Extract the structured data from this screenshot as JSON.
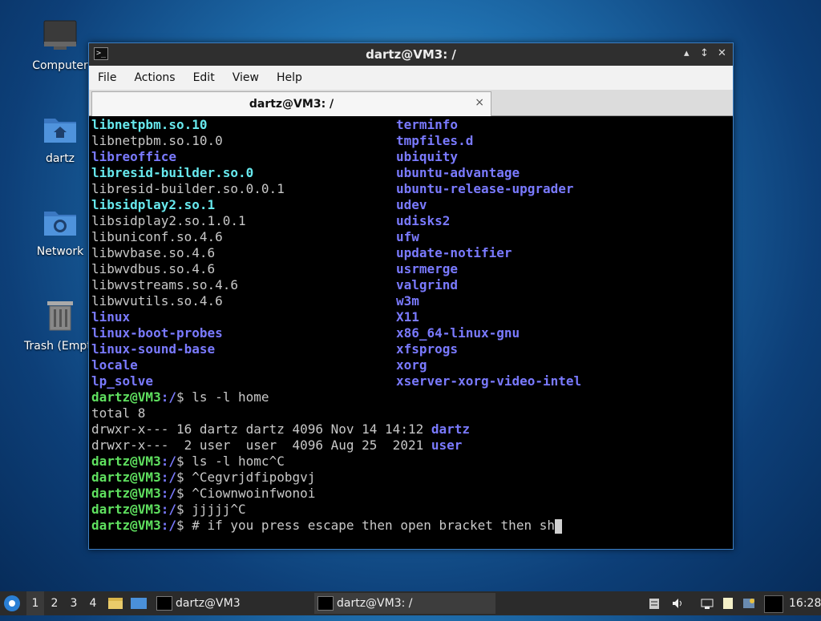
{
  "desktop": {
    "icons": [
      {
        "label": "Computer"
      },
      {
        "label": "dartz"
      },
      {
        "label": "Network"
      },
      {
        "label": "Trash (Empty)"
      }
    ]
  },
  "window": {
    "title": "dartz@VM3: /",
    "menu": [
      "File",
      "Actions",
      "Edit",
      "View",
      "Help"
    ],
    "tab_label": "dartz@VM3: /",
    "tab_close": "×",
    "controls": {
      "minimize": "▴",
      "maximize": "↕",
      "close": "✕"
    }
  },
  "terminal": {
    "listing": [
      {
        "left": "libnetpbm.so.10",
        "lc": "cy",
        "right": "terminfo",
        "rc": "bl"
      },
      {
        "left": "libnetpbm.so.10.0",
        "lc": "w",
        "right": "tmpfiles.d",
        "rc": "bl"
      },
      {
        "left": "libreoffice",
        "lc": "bl",
        "right": "ubiquity",
        "rc": "bl"
      },
      {
        "left": "libresid-builder.so.0",
        "lc": "cy",
        "right": "ubuntu-advantage",
        "rc": "bl"
      },
      {
        "left": "libresid-builder.so.0.0.1",
        "lc": "w",
        "right": "ubuntu-release-upgrader",
        "rc": "bl"
      },
      {
        "left": "libsidplay2.so.1",
        "lc": "cy",
        "right": "udev",
        "rc": "bl"
      },
      {
        "left": "libsidplay2.so.1.0.1",
        "lc": "w",
        "right": "udisks2",
        "rc": "bl"
      },
      {
        "left": "libuniconf.so.4.6",
        "lc": "w",
        "right": "ufw",
        "rc": "bl"
      },
      {
        "left": "libwvbase.so.4.6",
        "lc": "w",
        "right": "update-notifier",
        "rc": "bl"
      },
      {
        "left": "libwvdbus.so.4.6",
        "lc": "w",
        "right": "usrmerge",
        "rc": "bl"
      },
      {
        "left": "libwvstreams.so.4.6",
        "lc": "w",
        "right": "valgrind",
        "rc": "bl"
      },
      {
        "left": "libwvutils.so.4.6",
        "lc": "w",
        "right": "w3m",
        "rc": "bl"
      },
      {
        "left": "linux",
        "lc": "bl",
        "right": "X11",
        "rc": "bl"
      },
      {
        "left": "linux-boot-probes",
        "lc": "bl",
        "right": "x86_64-linux-gnu",
        "rc": "bl"
      },
      {
        "left": "linux-sound-base",
        "lc": "bl",
        "right": "xfsprogs",
        "rc": "bl"
      },
      {
        "left": "locale",
        "lc": "bl",
        "right": "xorg",
        "rc": "bl"
      },
      {
        "left": "lp_solve",
        "lc": "bl",
        "right": "xserver-xorg-video-intel",
        "rc": "bl"
      }
    ],
    "prompt_user": "dartz@VM3",
    "prompt_path": ":/",
    "prompt_sign": "$ ",
    "cmd1": "ls -l home",
    "total": "total 8",
    "ls_rows": [
      {
        "text": "drwxr-x--- 16 dartz dartz 4096 Nov 14 14:12 ",
        "name": "dartz"
      },
      {
        "text": "drwxr-x---  2 user  user  4096 Aug 25  2021 ",
        "name": "user"
      }
    ],
    "cmd2": "ls -l homc^C",
    "cmd3": "^Cegvrjdfipobgvj",
    "cmd4": "^Ciownwoinfwonoi",
    "cmd5": "jjjjj^C",
    "cmd6": "# if you press escape then open bracket then sh"
  },
  "taskbar": {
    "workspaces": [
      "1",
      "2",
      "3",
      "4"
    ],
    "tasks": [
      {
        "label": "dartz@VM3"
      },
      {
        "label": "dartz@VM3: /"
      }
    ],
    "clock": "16:28"
  }
}
